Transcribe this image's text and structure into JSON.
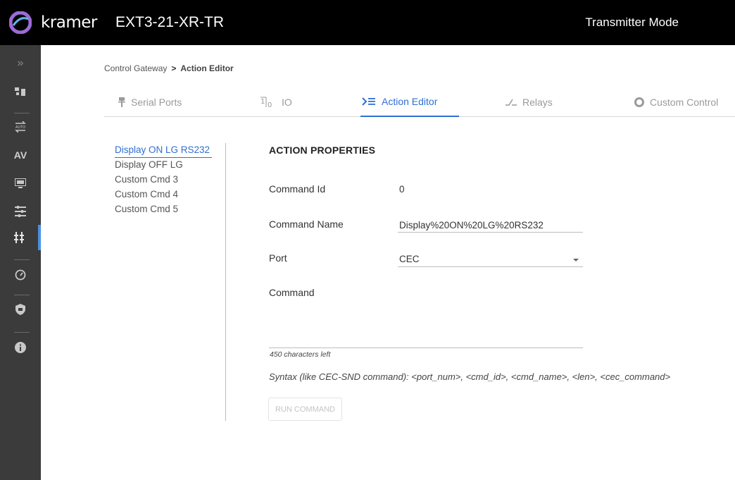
{
  "header": {
    "brand": "kramer",
    "device": "EXT3-21-XR-TR",
    "mode": "Transmitter Mode"
  },
  "sidebar": {
    "items": [
      {
        "icon": "expand-icon",
        "glyph": "»"
      },
      {
        "icon": "topology-icon"
      },
      {
        "icon": "auto-switch-icon",
        "glyph": "AUTO"
      },
      {
        "icon": "av-icon",
        "label": "AV"
      },
      {
        "icon": "edid-icon",
        "glyph": "EDID"
      },
      {
        "icon": "settings-sliders-icon"
      },
      {
        "icon": "control-gateway-icon",
        "active": true
      },
      {
        "icon": "diagnostics-gauge-icon"
      },
      {
        "icon": "security-shield-icon"
      },
      {
        "icon": "info-icon"
      }
    ]
  },
  "breadcrumb": {
    "parent": "Control Gateway",
    "separator": ">",
    "current": "Action Editor"
  },
  "tabs": [
    {
      "label": "Serial Ports",
      "icon": "serial-port-icon"
    },
    {
      "label": "IO",
      "icon": "io-icon"
    },
    {
      "label": "Action Editor",
      "icon": "action-editor-icon",
      "active": true
    },
    {
      "label": "Relays",
      "icon": "relay-icon"
    },
    {
      "label": "Custom Control",
      "icon": "custom-control-icon"
    }
  ],
  "commands": [
    {
      "label": "Display ON LG RS232",
      "active": true
    },
    {
      "label": "Display OFF LG"
    },
    {
      "label": "Custom Cmd 3"
    },
    {
      "label": "Custom Cmd 4"
    },
    {
      "label": "Custom Cmd 5"
    }
  ],
  "properties": {
    "title": "ACTION PROPERTIES",
    "command_id_label": "Command Id",
    "command_id_value": "0",
    "command_name_label": "Command Name",
    "command_name_value": "Display%20ON%20LG%20RS232",
    "port_label": "Port",
    "port_value": "CEC",
    "command_label": "Command",
    "command_value": "",
    "chars_left": "450 characters left",
    "syntax": "Syntax (like CEC-SND command): <port_num>, <cmd_id>, <cmd_name>, <len>, <cec_command>",
    "run_button": "RUN COMMAND"
  },
  "colors": {
    "accent": "#2f6fd1",
    "header_bg": "#000000",
    "sidebar_bg": "#3b3b3b"
  }
}
